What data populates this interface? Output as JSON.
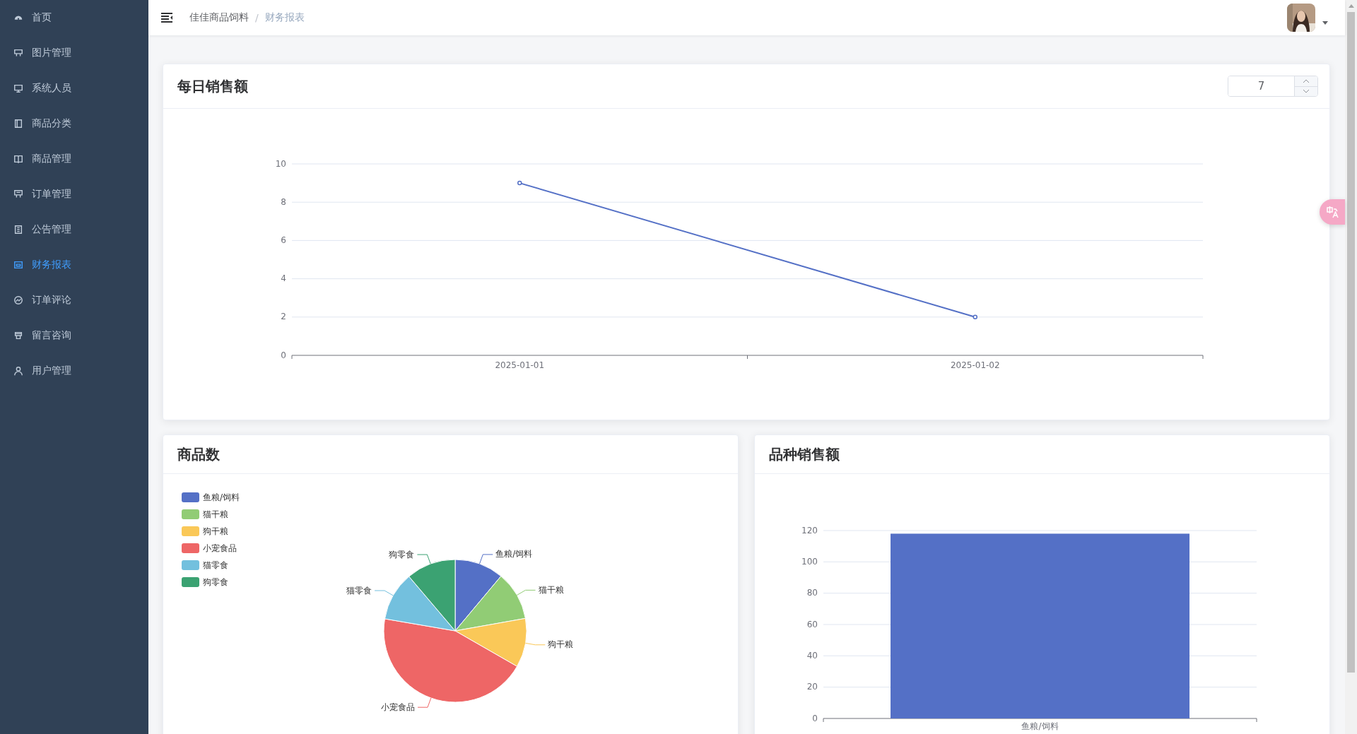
{
  "sidebar": {
    "items": [
      {
        "label": "首页",
        "selected": false
      },
      {
        "label": "图片管理",
        "selected": false
      },
      {
        "label": "系统人员",
        "selected": false
      },
      {
        "label": "商品分类",
        "selected": false
      },
      {
        "label": "商品管理",
        "selected": false
      },
      {
        "label": "订单管理",
        "selected": false
      },
      {
        "label": "公告管理",
        "selected": false
      },
      {
        "label": "财务报表",
        "selected": true
      },
      {
        "label": "订单评论",
        "selected": false
      },
      {
        "label": "留言咨询",
        "selected": false
      },
      {
        "label": "用户管理",
        "selected": false
      }
    ]
  },
  "header": {
    "breadcrumb": [
      "佳佳商品饲料",
      "财务报表"
    ],
    "breadcrumb_separator": "/"
  },
  "daily_sales": {
    "title": "每日销售额",
    "days_input": {
      "value": "7"
    },
    "chart_data": {
      "type": "line",
      "categories": [
        "2025-01-01",
        "2025-01-02"
      ],
      "series": [
        {
          "color": "#5470c6",
          "values": [
            9,
            2
          ],
          "marker": "circle"
        }
      ],
      "ylim": [
        0,
        10
      ],
      "yticks": [
        0,
        2,
        4,
        6,
        8,
        10
      ],
      "grid": true
    }
  },
  "product_count": {
    "title": "商品数",
    "legend": [
      {
        "label": "鱼粮/饲料",
        "color": "#5470c6"
      },
      {
        "label": "猫干粮",
        "color": "#91cc75"
      },
      {
        "label": "狗干粮",
        "color": "#fac858"
      },
      {
        "label": "小宠食品",
        "color": "#ee6666"
      },
      {
        "label": "猫零食",
        "color": "#73c0de"
      },
      {
        "label": "狗零食",
        "color": "#3ba272"
      }
    ],
    "chart_data": {
      "type": "pie",
      "categories": [
        "鱼粮/饲料",
        "猫干粮",
        "狗干粮",
        "小宠食品",
        "猫零食",
        "狗零食"
      ],
      "values": [
        11.1,
        11.1,
        11.1,
        44.4,
        11.1,
        11.2
      ]
    }
  },
  "category_sales": {
    "title": "品种销售额",
    "chart_data": {
      "type": "bar",
      "categories": [
        "鱼粮/饲料"
      ],
      "series": [
        {
          "color": "#5470c6",
          "values": [
            118
          ]
        }
      ],
      "ylim": [
        0,
        120
      ],
      "yticks": [
        0,
        20,
        40,
        60,
        80,
        100,
        120
      ],
      "grid": true
    }
  }
}
